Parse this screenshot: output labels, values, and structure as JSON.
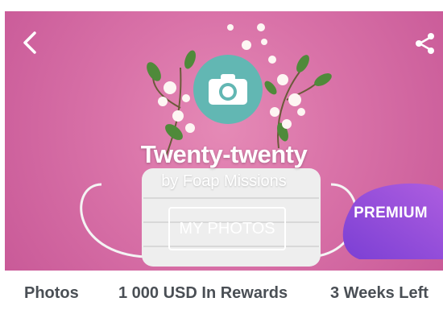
{
  "header": {
    "back_icon": "chevron-left-icon",
    "share_icon": "share-icon",
    "camera_icon": "camera-icon"
  },
  "mission": {
    "title": "Twenty-twenty",
    "subtitle": "by Foap Missions",
    "my_photos_label": "MY PHOTOS",
    "premium_label": "PREMIUM"
  },
  "stats": {
    "photos": "Photos",
    "rewards": "1 000 USD In Rewards",
    "time_left": "3 Weeks Left"
  },
  "colors": {
    "hero_pink": "#d972a8",
    "camera_teal": "#62b7b3",
    "premium_purple": "#8a4fd8",
    "stats_text": "#4a4f55"
  }
}
